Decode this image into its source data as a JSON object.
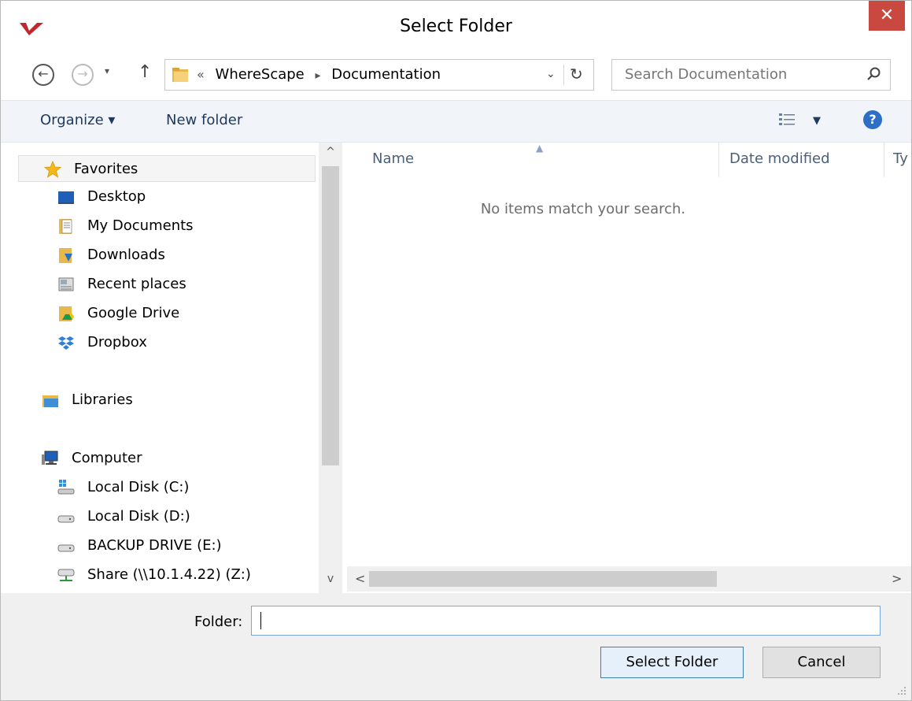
{
  "window": {
    "title": "Select Folder",
    "close_glyph": "✕"
  },
  "nav": {
    "back_glyph": "←",
    "forward_glyph": "→",
    "recent_glyph": "▾",
    "up_glyph": "↑",
    "address": {
      "prefix": "«",
      "crumbs": [
        "WhereScape",
        "Documentation"
      ],
      "separator": "▸"
    },
    "dropdown_glyph": "⌄",
    "refresh_glyph": "↻",
    "search_placeholder": "Search Documentation"
  },
  "commands": {
    "organize": "Organize ▾",
    "new_folder": "New folder",
    "view_drop": "▼",
    "help": "?"
  },
  "tree": {
    "favorites": "Favorites",
    "favorites_items": [
      "Desktop",
      "My Documents",
      "Downloads",
      "Recent places",
      "Google Drive",
      "Dropbox"
    ],
    "libraries": "Libraries",
    "computer": "Computer",
    "computer_items": [
      "Local Disk (C:)",
      "Local Disk (D:)",
      "BACKUP DRIVE (E:)",
      "Share (\\\\10.1.4.22) (Z:)"
    ]
  },
  "list": {
    "columns": [
      "Name",
      "Date modified",
      "Ty"
    ],
    "empty_message": "No items match your search."
  },
  "scroll": {
    "up": "^",
    "down": "v",
    "left": "<",
    "right": ">"
  },
  "footer": {
    "folder_label": "Folder:",
    "folder_value": "",
    "select_button": "Select Folder",
    "cancel_button": "Cancel"
  },
  "colors": {
    "accent": "#3c7fb1",
    "close_red": "#c9483f",
    "command_bar": "#f1f4f9",
    "footer": "#f0f0f0"
  }
}
